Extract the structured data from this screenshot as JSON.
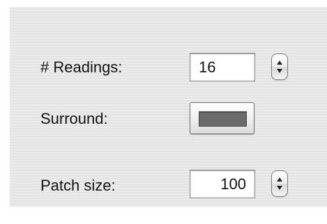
{
  "readings": {
    "label": "# Readings:",
    "value": "16"
  },
  "surround": {
    "label": "Surround:",
    "color": "#6c6c6c"
  },
  "patch_size": {
    "label": "Patch size:",
    "value": "100"
  },
  "icons": {
    "stepper": "up-down-arrows-icon"
  }
}
